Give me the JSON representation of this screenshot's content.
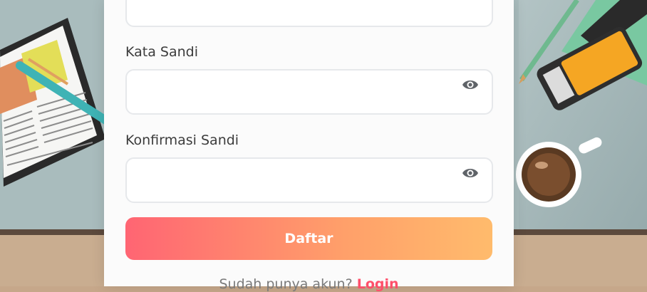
{
  "form": {
    "password_label": "Kata Sandi",
    "confirm_label": "Konfirmasi Sandi",
    "submit_label": "Daftar",
    "login_prompt": "Sudah punya akun?",
    "login_link": "Login"
  },
  "icons": {
    "toggle_password": "eye-icon",
    "toggle_confirm": "eye-icon"
  },
  "colors": {
    "button_gradient_start": "#ff6573",
    "button_gradient_end": "#ffbb6c",
    "link": "#ff4f6a",
    "label_text": "#3c3c3c"
  }
}
